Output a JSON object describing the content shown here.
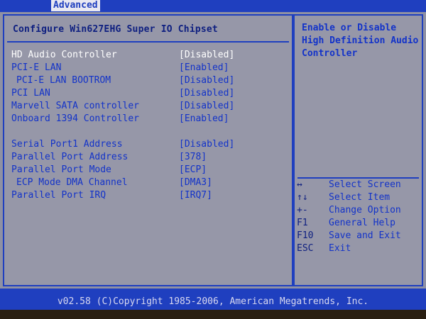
{
  "header": {
    "tab_label": "Advanced"
  },
  "main": {
    "title": "Configure Win627EHG Super IO Chipset",
    "options": [
      {
        "label": "HD Audio Controller",
        "value": "[Disabled]"
      },
      {
        "label": "PCI-E LAN",
        "value": "[Enabled]"
      },
      {
        "label": "PCI-E LAN BOOTROM",
        "value": "[Disabled]"
      },
      {
        "label": "PCI LAN",
        "value": "[Disabled]"
      },
      {
        "label": "Marvell SATA controller",
        "value": "[Disabled]"
      },
      {
        "label": "Onboard 1394 Controller",
        "value": "[Enabled]"
      },
      {
        "label": "Serial Port1 Address",
        "value": "[Disabled]"
      },
      {
        "label": "Parallel Port Address",
        "value": "[378]"
      },
      {
        "label": "Parallel Port Mode",
        "value": "[ECP]"
      },
      {
        "label": "ECP Mode DMA Channel",
        "value": "[DMA3]"
      },
      {
        "label": "Parallel Port IRQ",
        "value": "[IRQ7]"
      }
    ]
  },
  "help": {
    "lines": [
      "Enable or Disable",
      "High Definition Audio",
      "Controller"
    ],
    "keys": [
      {
        "key": "↔",
        "desc": "Select Screen"
      },
      {
        "key": "↑↓",
        "desc": "Select Item"
      },
      {
        "key": "+-",
        "desc": "Change Option"
      },
      {
        "key": "F1",
        "desc": "General Help"
      },
      {
        "key": "F10",
        "desc": "Save and Exit"
      },
      {
        "key": "ESC",
        "desc": "Exit"
      }
    ]
  },
  "footer": {
    "copyright": "v02.58 (C)Copyright 1985-2006, American Megatrends, Inc."
  },
  "colors": {
    "bios_blue": "#1f3fbf",
    "panel_gray": "#9697a8",
    "text_blue": "#1333c9",
    "highlight_white": "#ffffff"
  }
}
